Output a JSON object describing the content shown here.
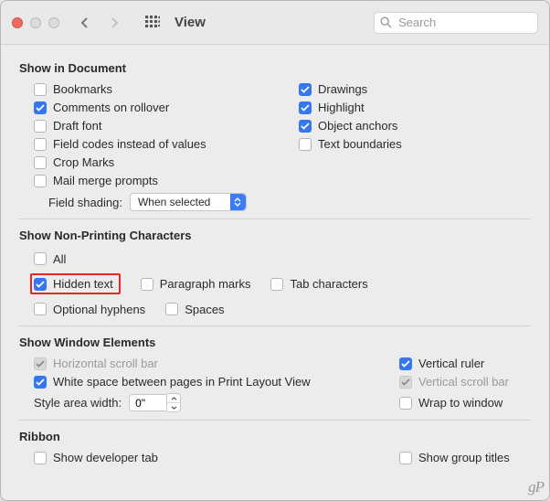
{
  "toolbar": {
    "title": "View",
    "search_placeholder": "Search"
  },
  "sections": {
    "show_in_document": {
      "title": "Show in Document",
      "left": [
        {
          "label": "Bookmarks",
          "checked": false
        },
        {
          "label": "Comments on rollover",
          "checked": true
        },
        {
          "label": "Draft font",
          "checked": false
        },
        {
          "label": "Field codes instead of values",
          "checked": false
        },
        {
          "label": "Crop Marks",
          "checked": false
        },
        {
          "label": "Mail merge prompts",
          "checked": false
        }
      ],
      "right": [
        {
          "label": "Drawings",
          "checked": true
        },
        {
          "label": "Highlight",
          "checked": true
        },
        {
          "label": "Object anchors",
          "checked": true
        },
        {
          "label": "Text boundaries",
          "checked": false
        }
      ],
      "field_shading_label": "Field shading:",
      "field_shading_value": "When selected"
    },
    "non_printing": {
      "title": "Show Non-Printing Characters",
      "items": {
        "all": {
          "label": "All",
          "checked": false
        },
        "hidden_text": {
          "label": "Hidden text",
          "checked": true
        },
        "paragraph_marks": {
          "label": "Paragraph marks",
          "checked": false
        },
        "tab_characters": {
          "label": "Tab characters",
          "checked": false
        },
        "optional_hyphens": {
          "label": "Optional hyphens",
          "checked": false
        },
        "spaces": {
          "label": "Spaces",
          "checked": false
        }
      }
    },
    "window_elements": {
      "title": "Show Window Elements",
      "horizontal_scroll": {
        "label": "Horizontal scroll bar",
        "checked": true,
        "disabled": true
      },
      "vertical_ruler": {
        "label": "Vertical ruler",
        "checked": true,
        "disabled": false
      },
      "white_space": {
        "label": "White space between pages in Print Layout View",
        "checked": true,
        "disabled": false
      },
      "vertical_scroll": {
        "label": "Vertical scroll bar",
        "checked": true,
        "disabled": true
      },
      "style_area_label": "Style area width:",
      "style_area_value": "0\"",
      "wrap_to_window": {
        "label": "Wrap to window",
        "checked": false,
        "disabled": false
      }
    },
    "ribbon": {
      "title": "Ribbon",
      "show_developer": {
        "label": "Show developer tab",
        "checked": false
      },
      "show_group_titles": {
        "label": "Show group titles",
        "checked": false
      }
    }
  },
  "watermark": "gP"
}
